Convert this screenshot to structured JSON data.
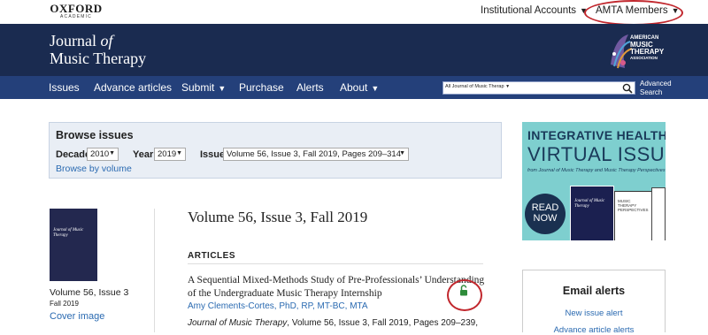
{
  "header": {
    "publisher_name": "OXFORD",
    "publisher_sub": "ACADEMIC",
    "institutional_accounts": "Institutional Accounts",
    "amta_members": "AMTA Members"
  },
  "banner": {
    "journal_line1a": "Journal",
    "journal_line1b": "of",
    "journal_line2": "Music Therapy",
    "amta_logo_lines": [
      "AMERICAN",
      "MUSIC",
      "THERAPY",
      "ASSOCIATION"
    ]
  },
  "nav": {
    "items": [
      "Issues",
      "Advance articles",
      "Submit",
      "Purchase",
      "Alerts",
      "About"
    ],
    "search_scope": "All Journal of Music Therap",
    "advanced_search": "Advanced Search"
  },
  "browse": {
    "heading": "Browse issues",
    "decade_label": "Decade",
    "decade_value": "2010",
    "year_label": "Year",
    "year_value": "2019",
    "issue_label": "Issue",
    "issue_value": "Volume 56, Issue 3, Fall 2019, Pages 209–314",
    "browse_by_volume": "Browse by volume"
  },
  "ad": {
    "line1": "INTEGRATIVE HEALTH",
    "line2": "VIRTUAL ISSUE",
    "line3": "from Journal of Music Therapy and Music Therapy Perspectives",
    "read_now": "READ NOW",
    "book1": "Journal of Music Therapy",
    "book2": "MUSIC THERAPY PERSPECTIVES"
  },
  "issue": {
    "cover_title": "Journal of Music Therapy",
    "cover_label": "Volume 56, Issue 3",
    "cover_date": "Fall 2019",
    "cover_image_link": "Cover image",
    "volume_title": "Volume 56, Issue 3, Fall 2019",
    "section": "ARTICLES"
  },
  "article": {
    "title": "A Sequential Mixed-Methods Study of Pre-Professionals’ Understanding of the Undergraduate Music Therapy Internship",
    "author": "Amy Clements-Cortes, PhD, RP, MT-BC, MTA",
    "cite_journal": "Journal of Music Therapy",
    "cite_rest": ", Volume 56, Issue 3, Fall 2019, Pages 209–239,"
  },
  "email": {
    "heading": "Email alerts",
    "link1": "New issue alert",
    "link2": "Advance article alerts"
  },
  "colors": {
    "banner": "#1a2b50",
    "nav": "#24407a",
    "link": "#2a6ab1",
    "annotation": "#c1272d",
    "lock": "#2e8b3a"
  }
}
